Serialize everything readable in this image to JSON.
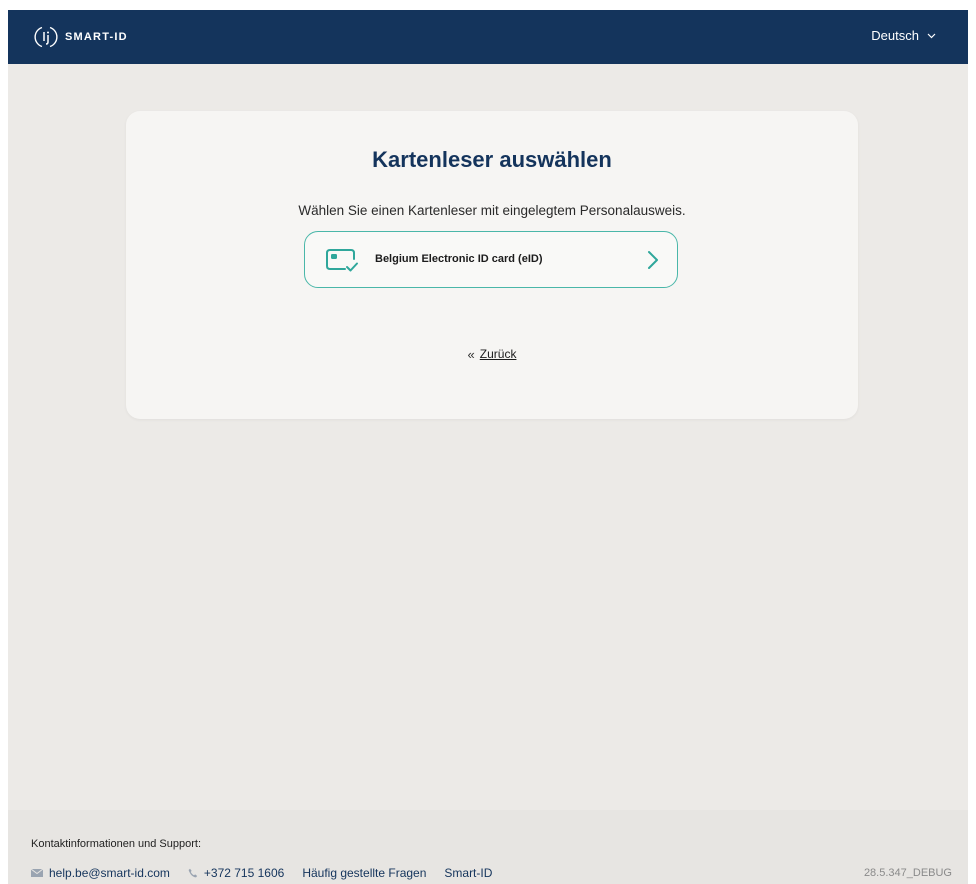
{
  "header": {
    "logo_text": "SMART-ID",
    "language": "Deutsch",
    "icons": {
      "logo": "smart-id-logo-icon",
      "language_toggle": "chevron-down-icon"
    }
  },
  "main": {
    "title": "Kartenleser auswählen",
    "subtitle": "Wählen Sie einen Kartenleser mit eingelegtem Personalausweis.",
    "readers": [
      {
        "label": "Belgium Electronic ID card (eID)",
        "icon": "id-card-check-icon"
      }
    ],
    "back": {
      "icon_glyph": "«",
      "label": "Zurück"
    }
  },
  "footer": {
    "heading": "Kontaktinformationen und Support:",
    "email": "help.be@smart-id.com",
    "phone": "+372 715 1606",
    "faq": "Häufig gestellte Fragen",
    "smart_id": "Smart-ID",
    "version": "28.5.347_DEBUG"
  },
  "colors": {
    "header_bg": "#14345c",
    "accent": "#4ab7a9",
    "page_bg": "#eceae7",
    "card_bg": "#f6f5f3",
    "footer_bg": "#e7e5e2"
  }
}
